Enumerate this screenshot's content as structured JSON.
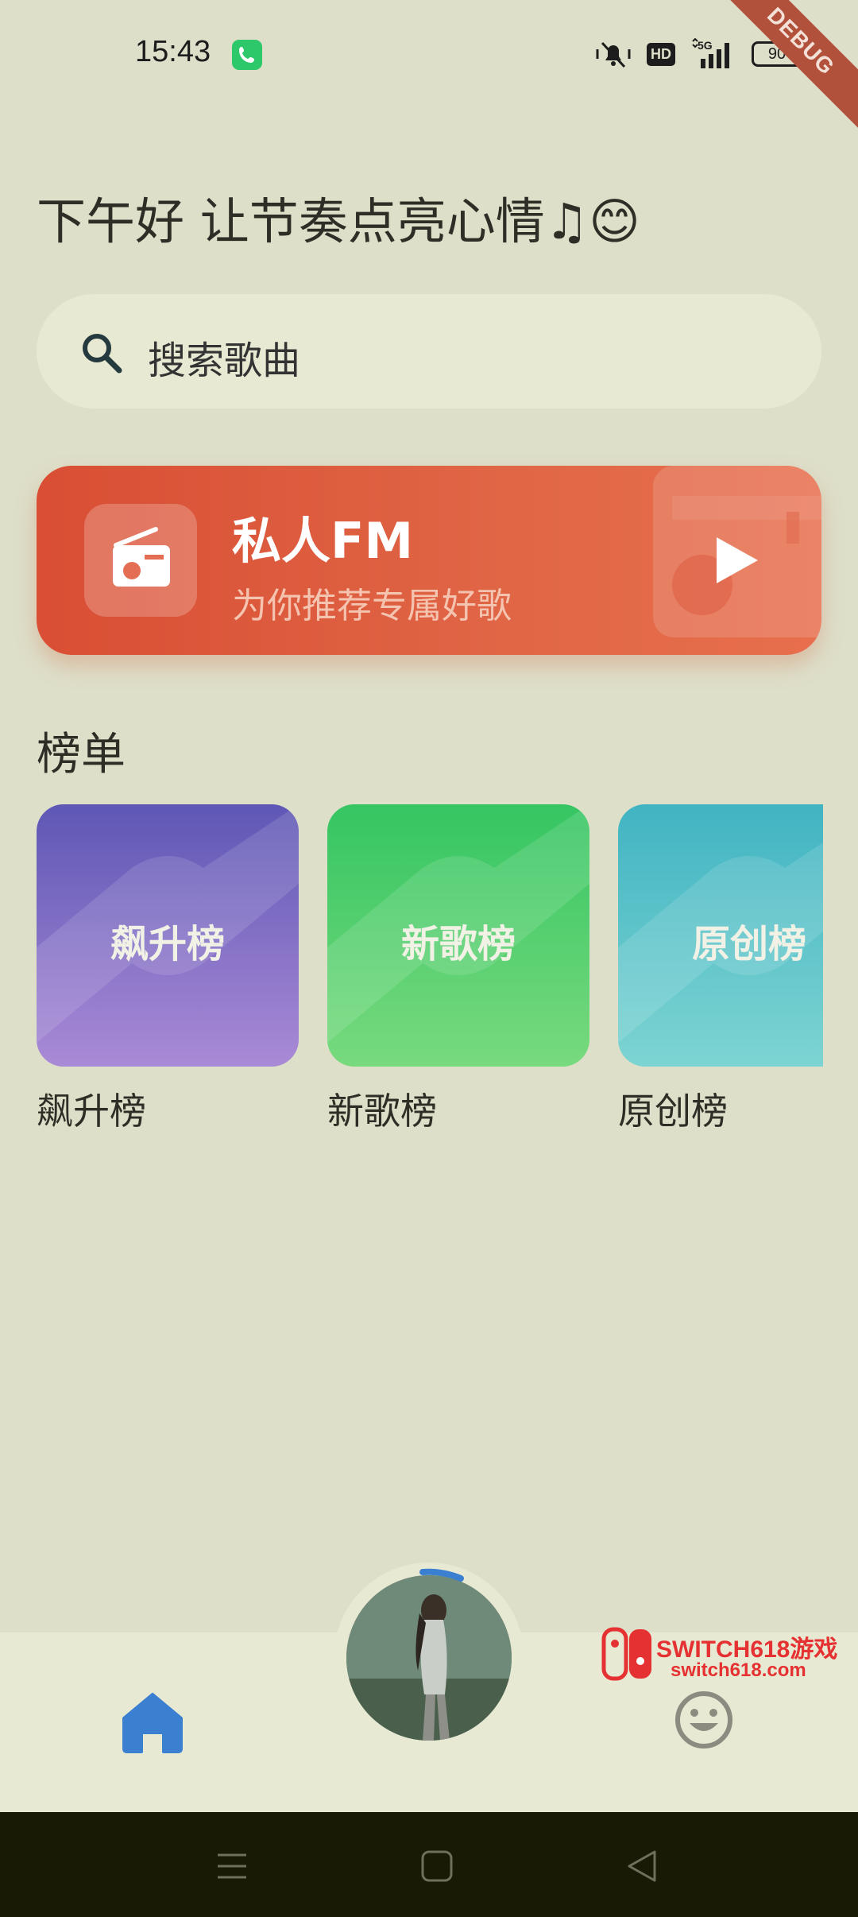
{
  "status_bar": {
    "time": "15:43",
    "network": "5G",
    "hd_label": "HD",
    "battery": "90",
    "debug_label": "DEBUG"
  },
  "greeting": "下午好 让节奏点亮心情♫😊",
  "search": {
    "placeholder": "搜索歌曲"
  },
  "fm_card": {
    "title": "私人FM",
    "subtitle": "为你推荐专属好歌",
    "gradient": [
      "#d94e34",
      "#e86f4e"
    ]
  },
  "charts_section": {
    "title": "榜单",
    "items": [
      {
        "tile_label": "飙升榜",
        "name": "飙升榜",
        "colors": [
          "#5e57b5",
          "#a98ad6"
        ]
      },
      {
        "tile_label": "新歌榜",
        "name": "新歌榜",
        "colors": [
          "#35c562",
          "#78da7e"
        ]
      },
      {
        "tile_label": "原创榜",
        "name": "原创榜",
        "colors": [
          "#41b4c2",
          "#7dd4d2"
        ]
      }
    ]
  },
  "bottom_nav": {
    "home_icon": "home-icon",
    "player_icon": "album-disc",
    "emoji_icon": "smiley-icon",
    "accent": "#3a7fd0"
  },
  "watermark": {
    "brand": "SWITCH618游戏",
    "url": "switch618.com"
  },
  "system_nav": [
    "menu-icon",
    "home-square-icon",
    "back-icon"
  ]
}
